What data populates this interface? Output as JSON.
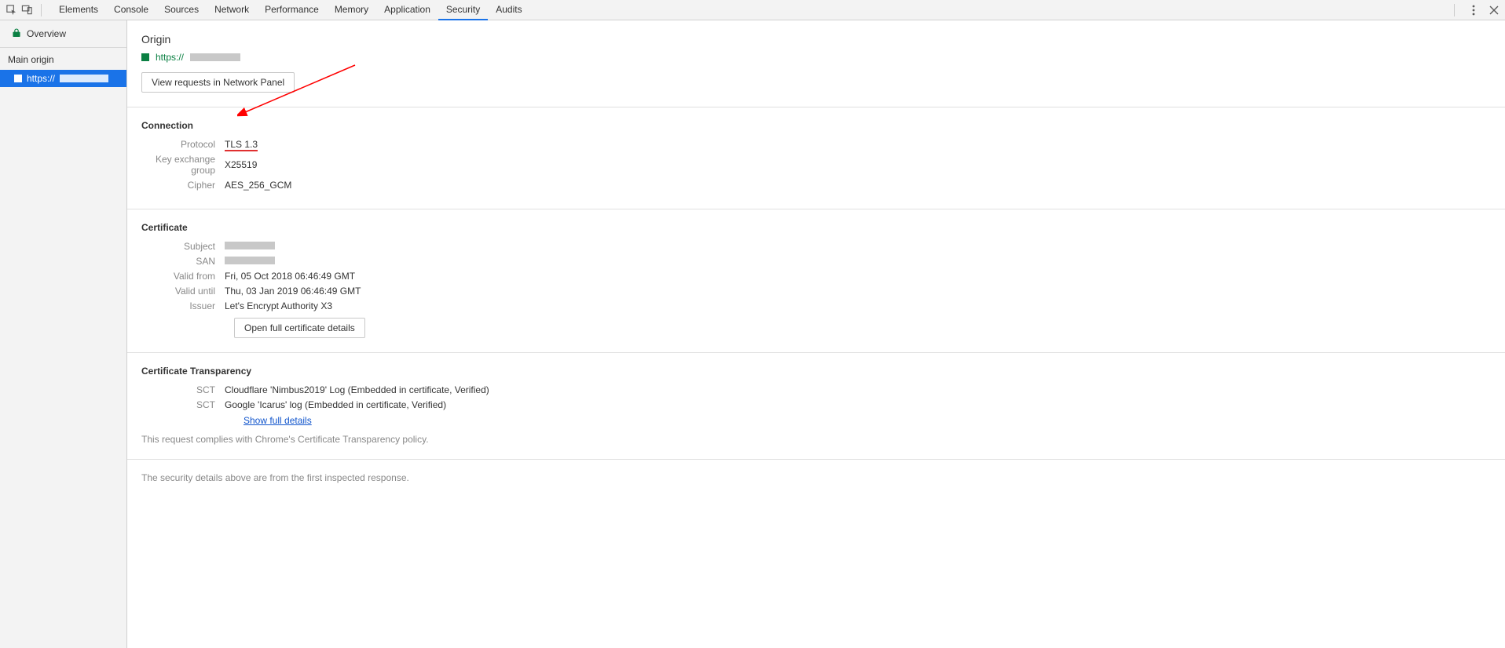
{
  "toolbar": {
    "tabs": [
      "Elements",
      "Console",
      "Sources",
      "Network",
      "Performance",
      "Memory",
      "Application",
      "Security",
      "Audits"
    ],
    "active_tab": "Security"
  },
  "sidebar": {
    "overview_label": "Overview",
    "main_origin_label": "Main origin",
    "origin_prefix": "https://"
  },
  "origin": {
    "title": "Origin",
    "url_prefix": "https://",
    "view_requests_btn": "View requests in Network Panel"
  },
  "connection": {
    "heading": "Connection",
    "labels": {
      "protocol": "Protocol",
      "kex": "Key exchange group",
      "cipher": "Cipher"
    },
    "values": {
      "protocol": "TLS 1.3",
      "kex": "X25519",
      "cipher": "AES_256_GCM"
    }
  },
  "certificate": {
    "heading": "Certificate",
    "labels": {
      "subject": "Subject",
      "san": "SAN",
      "valid_from": "Valid from",
      "valid_until": "Valid until",
      "issuer": "Issuer"
    },
    "values": {
      "valid_from": "Fri, 05 Oct 2018 06:46:49 GMT",
      "valid_until": "Thu, 03 Jan 2019 06:46:49 GMT",
      "issuer": "Let's Encrypt Authority X3"
    },
    "open_btn": "Open full certificate details"
  },
  "ct": {
    "heading": "Certificate Transparency",
    "sct_label": "SCT",
    "sct1": "Cloudflare 'Nimbus2019' Log (Embedded in certificate, Verified)",
    "sct2": "Google 'Icarus' log (Embedded in certificate, Verified)",
    "show_full": "Show full details",
    "compliance": "This request complies with Chrome's Certificate Transparency policy."
  },
  "footer": {
    "note": "The security details above are from the first inspected response."
  }
}
